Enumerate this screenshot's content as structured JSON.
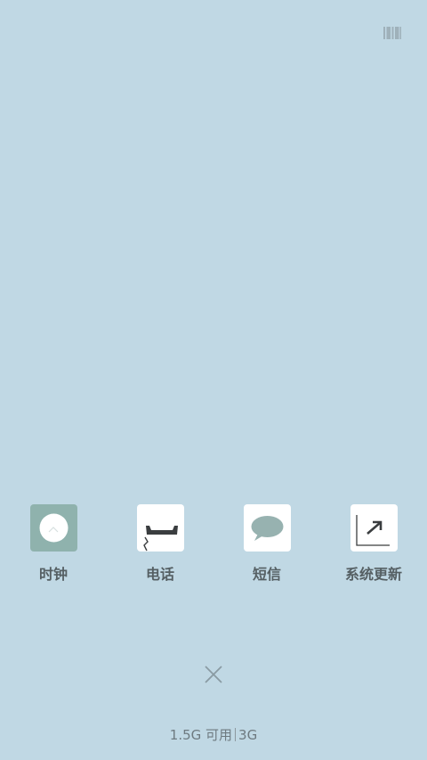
{
  "topbar": {
    "menu_icon": "barcode-menu-icon"
  },
  "apps": [
    {
      "label": "时钟",
      "icon": "clock-icon",
      "icon_bg": "#8fb2ad"
    },
    {
      "label": "电话",
      "icon": "phone-icon",
      "icon_bg": "#ffffff"
    },
    {
      "label": "短信",
      "icon": "message-bubble-icon",
      "icon_bg": "#ffffff"
    },
    {
      "label": "系统更新",
      "icon": "update-arrow-icon",
      "icon_bg": "#ffffff"
    }
  ],
  "close": {
    "icon": "close-icon"
  },
  "memory": {
    "available": "1.5G 可用",
    "total": "3G"
  },
  "colors": {
    "background": "#c0d8e4",
    "label_text": "#555f63",
    "status_text": "#6e7a80"
  }
}
